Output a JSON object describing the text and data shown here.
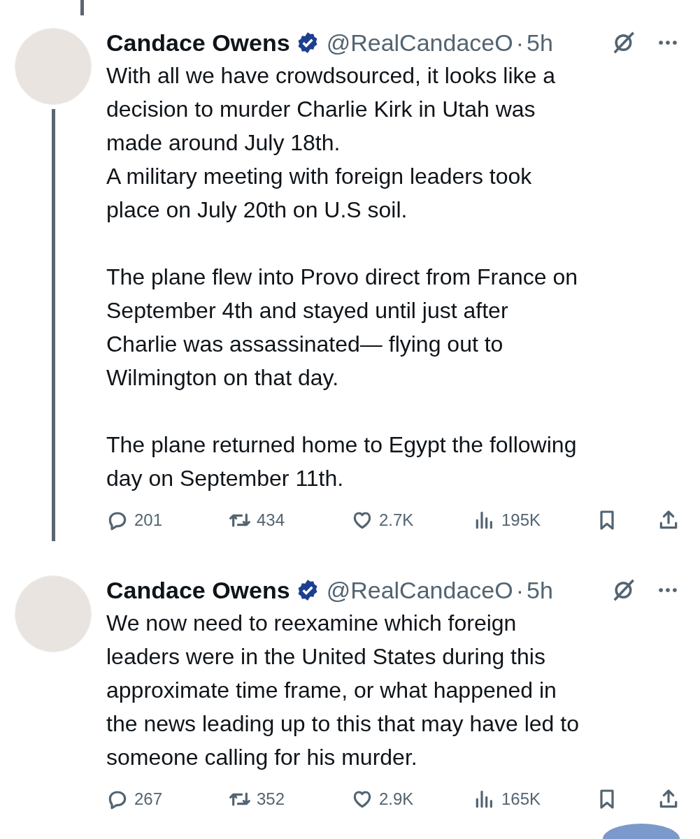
{
  "posts": [
    {
      "author": "Candace Owens",
      "verified": true,
      "handle": "@RealCandaceO",
      "separator": "·",
      "time": "5h",
      "paragraphs": [
        [
          "With all we have crowdsourced, it looks like a",
          "decision to murder Charlie Kirk in Utah was",
          "made around July 18th.",
          "A military meeting with foreign leaders took",
          "place on July 20th on U.S soil."
        ],
        [
          "The plane flew into Provo direct from France on",
          "September 4th and stayed until just after",
          "Charlie was assassinated— flying out to",
          "Wilmington on that day."
        ],
        [
          "The plane returned home to Egypt the following",
          "day on September 11th."
        ]
      ],
      "stats": {
        "replies": "201",
        "reposts": "434",
        "likes": "2.7K",
        "views": "195K"
      }
    },
    {
      "author": "Candace Owens",
      "verified": true,
      "handle": "@RealCandaceO",
      "separator": "·",
      "time": "5h",
      "paragraphs": [
        [
          "We now need to reexamine which foreign",
          "leaders were in the United States during this",
          "approximate time frame, or what happened in",
          "the news leading up to this that may have led to",
          "someone calling for his murder."
        ]
      ],
      "stats": {
        "replies": "267",
        "reposts": "352",
        "likes": "2.9K",
        "views": "165K"
      }
    }
  ]
}
